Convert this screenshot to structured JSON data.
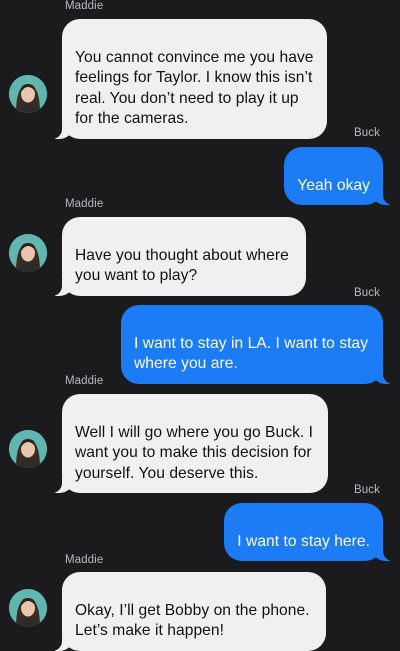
{
  "contacts": {
    "left_name": "Maddie",
    "right_name": "Buck"
  },
  "messages": [
    {
      "sender": "Maddie",
      "direction": "incoming",
      "text": "You cannot convince me you have\nfeelings for Taylor. I know this isn’t\nreal. You don’t need to play it up\nfor the cameras."
    },
    {
      "sender": "Buck",
      "direction": "outgoing",
      "text": "Yeah okay"
    },
    {
      "sender": "Maddie",
      "direction": "incoming",
      "text": "Have you thought about where\nyou want to play?"
    },
    {
      "sender": "Buck",
      "direction": "outgoing",
      "text": "I want to stay in LA. I want to stay\nwhere you are."
    },
    {
      "sender": "Maddie",
      "direction": "incoming",
      "text": "Well I will go where you go Buck. I\nwant you to make this decision for\nyourself. You deserve this."
    },
    {
      "sender": "Buck",
      "direction": "outgoing",
      "text": "I want to stay here."
    },
    {
      "sender": "Maddie",
      "direction": "incoming",
      "text": "Okay, I’ll get Bobby on the phone.\nLet’s make it happen!"
    }
  ],
  "colors": {
    "background": "#1b1b1d",
    "incoming_bubble": "#f0f0f2",
    "outgoing_bubble": "#1b7cf5",
    "sender_label": "#b9b9bd",
    "avatar_bg": "#5fb7b0"
  },
  "icons": {
    "avatar": "contact-photo-icon"
  }
}
